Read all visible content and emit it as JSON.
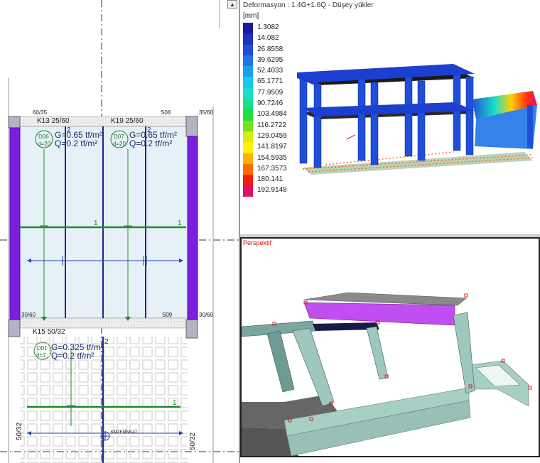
{
  "plan": {
    "scroll_up_glyph": "▲",
    "col_top_left": "60/35",
    "col_top_right": "35/60",
    "col_mid_left": "30/60",
    "col_mid_right": "30/60",
    "beam_1": "K13 25/60",
    "beam_2": "K19 25/60",
    "beam_3": "K15 50/32",
    "slab_top_label": "S08",
    "slab_mid_label": "S09",
    "slab_1_id": "D06",
    "slab_1_thk": "d=20",
    "slab_1_g": "G=0.65 tf/m²",
    "slab_1_q": "Q=0.2 tf/m²",
    "slab_2_id": "D07",
    "slab_2_thk": "d=20",
    "slab_2_g": "G=0.65 tf/m²",
    "slab_2_q": "Q=0.2 tf/m²",
    "slab_3_id": "D01",
    "slab_3_thk": "d=7",
    "slab_3_g": "G=0.325 tf/m²",
    "slab_3_q": "Q=0.2 tf/m²",
    "axis_1_left": "1",
    "axis_1_right": "1",
    "axis_1_bottom": "1",
    "axis_2_top_left": "2",
    "axis_2_top_right": "2",
    "axis_2_bottom": "2",
    "side_label_left": "50/32",
    "side_label_right": "50/32",
    "marker_label": "KMZEMNKAT"
  },
  "deform": {
    "title": "Deformasyon : 1.4G+1.6Q  -  Düşey yükler",
    "unit": "[mm]",
    "legend": [
      {
        "value": "1.3082",
        "color": "#1a1aa0"
      },
      {
        "value": "14.082",
        "color": "#1d2fc4"
      },
      {
        "value": "26.8558",
        "color": "#1f4fd8"
      },
      {
        "value": "39.6295",
        "color": "#1f74e8"
      },
      {
        "value": "52.4033",
        "color": "#1ba0f0"
      },
      {
        "value": "65.1771",
        "color": "#18c8f0"
      },
      {
        "value": "77.9509",
        "color": "#18e0c8"
      },
      {
        "value": "90.7246",
        "color": "#18e08a"
      },
      {
        "value": "103.4984",
        "color": "#22dd40"
      },
      {
        "value": "116.2722",
        "color": "#7ae020"
      },
      {
        "value": "129.0459",
        "color": "#d8ec10"
      },
      {
        "value": "141.8197",
        "color": "#fff000"
      },
      {
        "value": "154.5935",
        "color": "#ffb000"
      },
      {
        "value": "167.3573",
        "color": "#ff6a00"
      },
      {
        "value": "180.141",
        "color": "#f02010"
      },
      {
        "value": "192.9148",
        "color": "#e0106a"
      }
    ]
  },
  "persp": {
    "title": "Perspektif"
  }
}
